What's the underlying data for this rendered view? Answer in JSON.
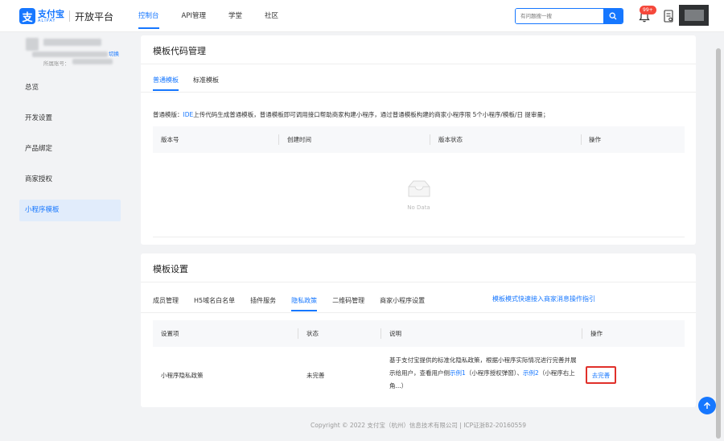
{
  "header": {
    "logo_cn": "支付宝",
    "logo_en": "ALIPAY",
    "logo_mark": "支",
    "platform": "开放平台",
    "nav": [
      {
        "label": "控制台",
        "active": true
      },
      {
        "label": "API管理",
        "active": false
      },
      {
        "label": "学堂",
        "active": false
      },
      {
        "label": "社区",
        "active": false
      }
    ],
    "search_placeholder": "有问题搜一搜",
    "notification_badge": "99+"
  },
  "sidebar": {
    "switch_label": "切换",
    "account_label": "所属账号：",
    "items": [
      {
        "label": "总览",
        "active": false
      },
      {
        "label": "开发设置",
        "active": false
      },
      {
        "label": "产品绑定",
        "active": false
      },
      {
        "label": "商家授权",
        "active": false
      },
      {
        "label": "小程序模板",
        "active": true
      }
    ]
  },
  "template_code": {
    "title": "模板代码管理",
    "tabs": [
      {
        "label": "普通模板",
        "active": true
      },
      {
        "label": "标准模板",
        "active": false
      }
    ],
    "notice_prefix": "普通模版：",
    "notice_link": "IDE",
    "notice_rest": "上传代码生成普通模板，普通模板即可调用接口帮助商家构建小程序，通过普通模板构建的商家小程序限 5个小程序/模板/日 提审量；",
    "columns": [
      "版本号",
      "创建时间",
      "版本状态",
      "操作"
    ],
    "empty_text": "No Data"
  },
  "template_settings": {
    "title": "模板设置",
    "tabs": [
      {
        "label": "成员管理",
        "active": false
      },
      {
        "label": "H5域名白名单",
        "active": false
      },
      {
        "label": "插件服务",
        "active": false
      },
      {
        "label": "隐私政策",
        "active": true
      },
      {
        "label": "二维码管理",
        "active": false
      },
      {
        "label": "商家小程序设置",
        "active": false
      }
    ],
    "guide_link": "模板模式快速接入商家消息操作指引",
    "columns": [
      "设置项",
      "状态",
      "说明",
      "操作"
    ],
    "row": {
      "item": "小程序隐私政策",
      "status": "未完善",
      "desc_part1": "基于支付宝提供的标准化隐私政策，根据小程序实际情况进行完善并展示给用户，查看用户侧",
      "desc_link1": "示例1",
      "desc_part2": "（小程序授权弹窗）、",
      "desc_link2": "示例2",
      "desc_part3": "（小程序右上角...）",
      "action": "去完善"
    }
  },
  "footer": "Copyright © 2022 支付宝（杭州）信息技术有限公司 | ICP证浙B2-20160559",
  "colors": {
    "accent": "#1677ff",
    "highlight_border": "#e0302a",
    "badge": "#f5483b"
  },
  "icons": [
    "search-icon",
    "bell-icon",
    "document-icon",
    "empty-box-icon",
    "arrow-up-icon"
  ]
}
